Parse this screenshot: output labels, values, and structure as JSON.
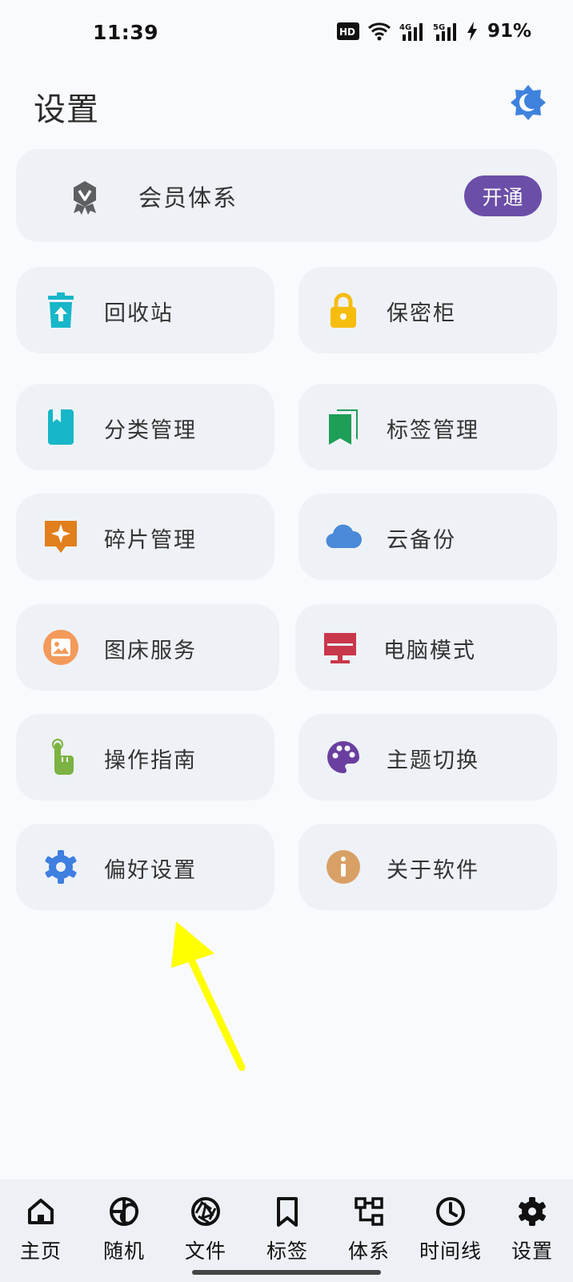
{
  "status_bar": {
    "time": "11:39",
    "battery": "91%",
    "hd_badge": "HD",
    "net_4g": "4G",
    "net_5g": "5G"
  },
  "header": {
    "title": "设置"
  },
  "vip": {
    "label": "会员体系",
    "button": "开通"
  },
  "tiles": [
    {
      "label": "回收站",
      "icon": "recycle-bin-icon",
      "color": "#17b6c8"
    },
    {
      "label": "保密柜",
      "icon": "lock-icon",
      "color": "#f6bd0e"
    },
    {
      "label": "分类管理",
      "icon": "book-icon",
      "color": "#17b6c8"
    },
    {
      "label": "标签管理",
      "icon": "bookmarks-icon",
      "color": "#1f9e57"
    },
    {
      "label": "碎片管理",
      "icon": "sparkle-note-icon",
      "color": "#e07f1c"
    },
    {
      "label": "云备份",
      "icon": "cloud-icon",
      "color": "#4a8ad8"
    },
    {
      "label": "图床服务",
      "icon": "image-icon",
      "color": "#f39a5a"
    },
    {
      "label": "电脑模式",
      "icon": "desktop-icon",
      "color": "#c9374a"
    },
    {
      "label": "操作指南",
      "icon": "touch-hand-icon",
      "color": "#7cb342"
    },
    {
      "label": "主题切换",
      "icon": "palette-icon",
      "color": "#6a3fa0"
    },
    {
      "label": "偏好设置",
      "icon": "gear-icon",
      "color": "#3e7fe0"
    },
    {
      "label": "关于软件",
      "icon": "info-icon",
      "color": "#d9a066"
    }
  ],
  "bottom_nav": [
    {
      "label": "主页",
      "icon": "home-icon"
    },
    {
      "label": "随机",
      "icon": "shuffle-icon"
    },
    {
      "label": "文件",
      "icon": "aperture-icon"
    },
    {
      "label": "标签",
      "icon": "bookmark-icon"
    },
    {
      "label": "体系",
      "icon": "hierarchy-icon"
    },
    {
      "label": "时间线",
      "icon": "clock-icon"
    },
    {
      "label": "设置",
      "icon": "settings-icon"
    }
  ]
}
